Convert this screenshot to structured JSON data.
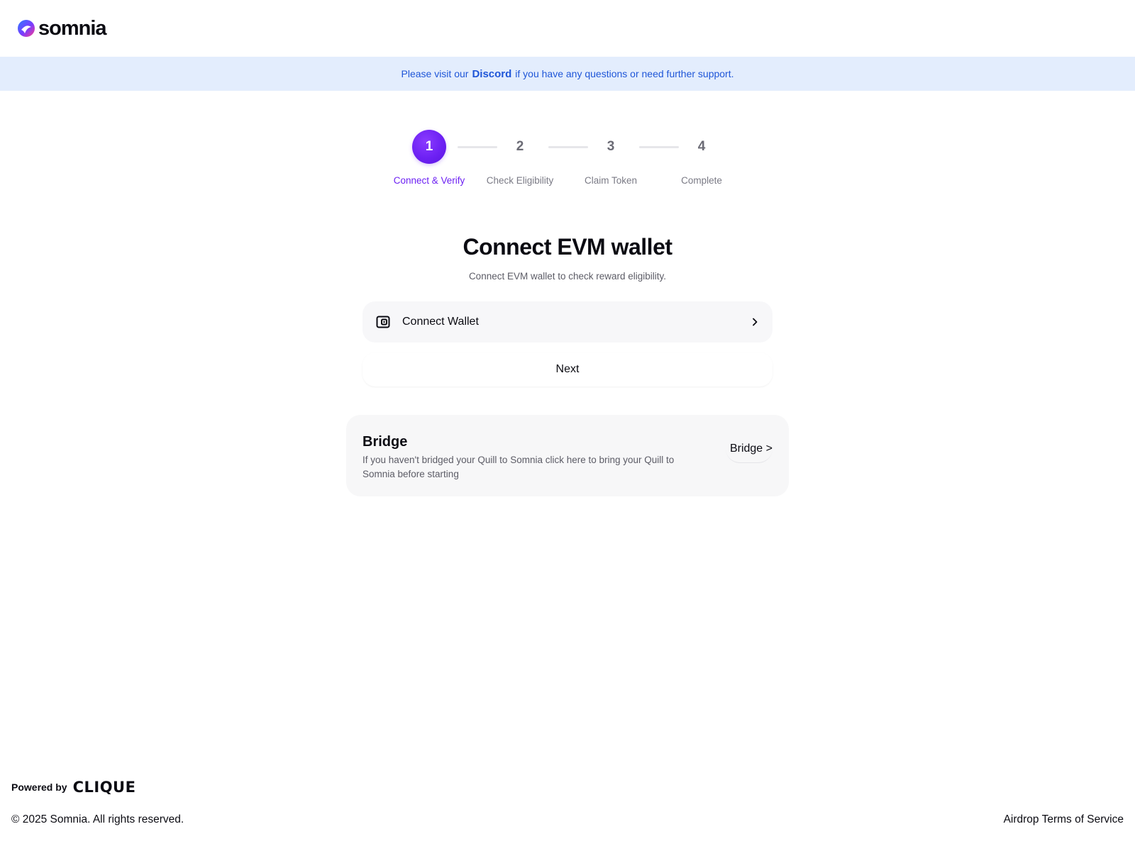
{
  "header": {
    "logo_text": "somnia"
  },
  "banner": {
    "prefix": "Please visit our",
    "link": "Discord",
    "suffix": "if you have any questions or need further support."
  },
  "stepper": {
    "active_step": 1,
    "steps": [
      {
        "number": "1",
        "label": "Connect & Verify"
      },
      {
        "number": "2",
        "label": "Check Eligibility"
      },
      {
        "number": "3",
        "label": "Claim Token"
      },
      {
        "number": "4",
        "label": "Complete"
      }
    ]
  },
  "main": {
    "title": "Connect EVM wallet",
    "subtitle": "Connect EVM wallet to check reward eligibility.",
    "connect_button_label": "Connect Wallet",
    "next_button_label": "Next"
  },
  "bridge": {
    "title": "Bridge",
    "description": "If you haven't bridged your Quill to Somnia click here to bring your Quill to Somnia before starting",
    "button_label": "Bridge >"
  },
  "footer": {
    "powered_by": "Powered by",
    "partner_logo": "CLIQUE",
    "copyright": "© 2025 Somnia. All rights reserved.",
    "terms_link": "Airdrop Terms of Service"
  },
  "colors": {
    "accent": "#6d21f3",
    "banner_bg": "#e3edfd",
    "banner_text": "#1f56d8",
    "muted_text": "#7a7a85"
  },
  "icons": {
    "logo": "somnia-logo-icon",
    "wallet": "wallet-icon",
    "chevron": "chevron-right-icon"
  }
}
